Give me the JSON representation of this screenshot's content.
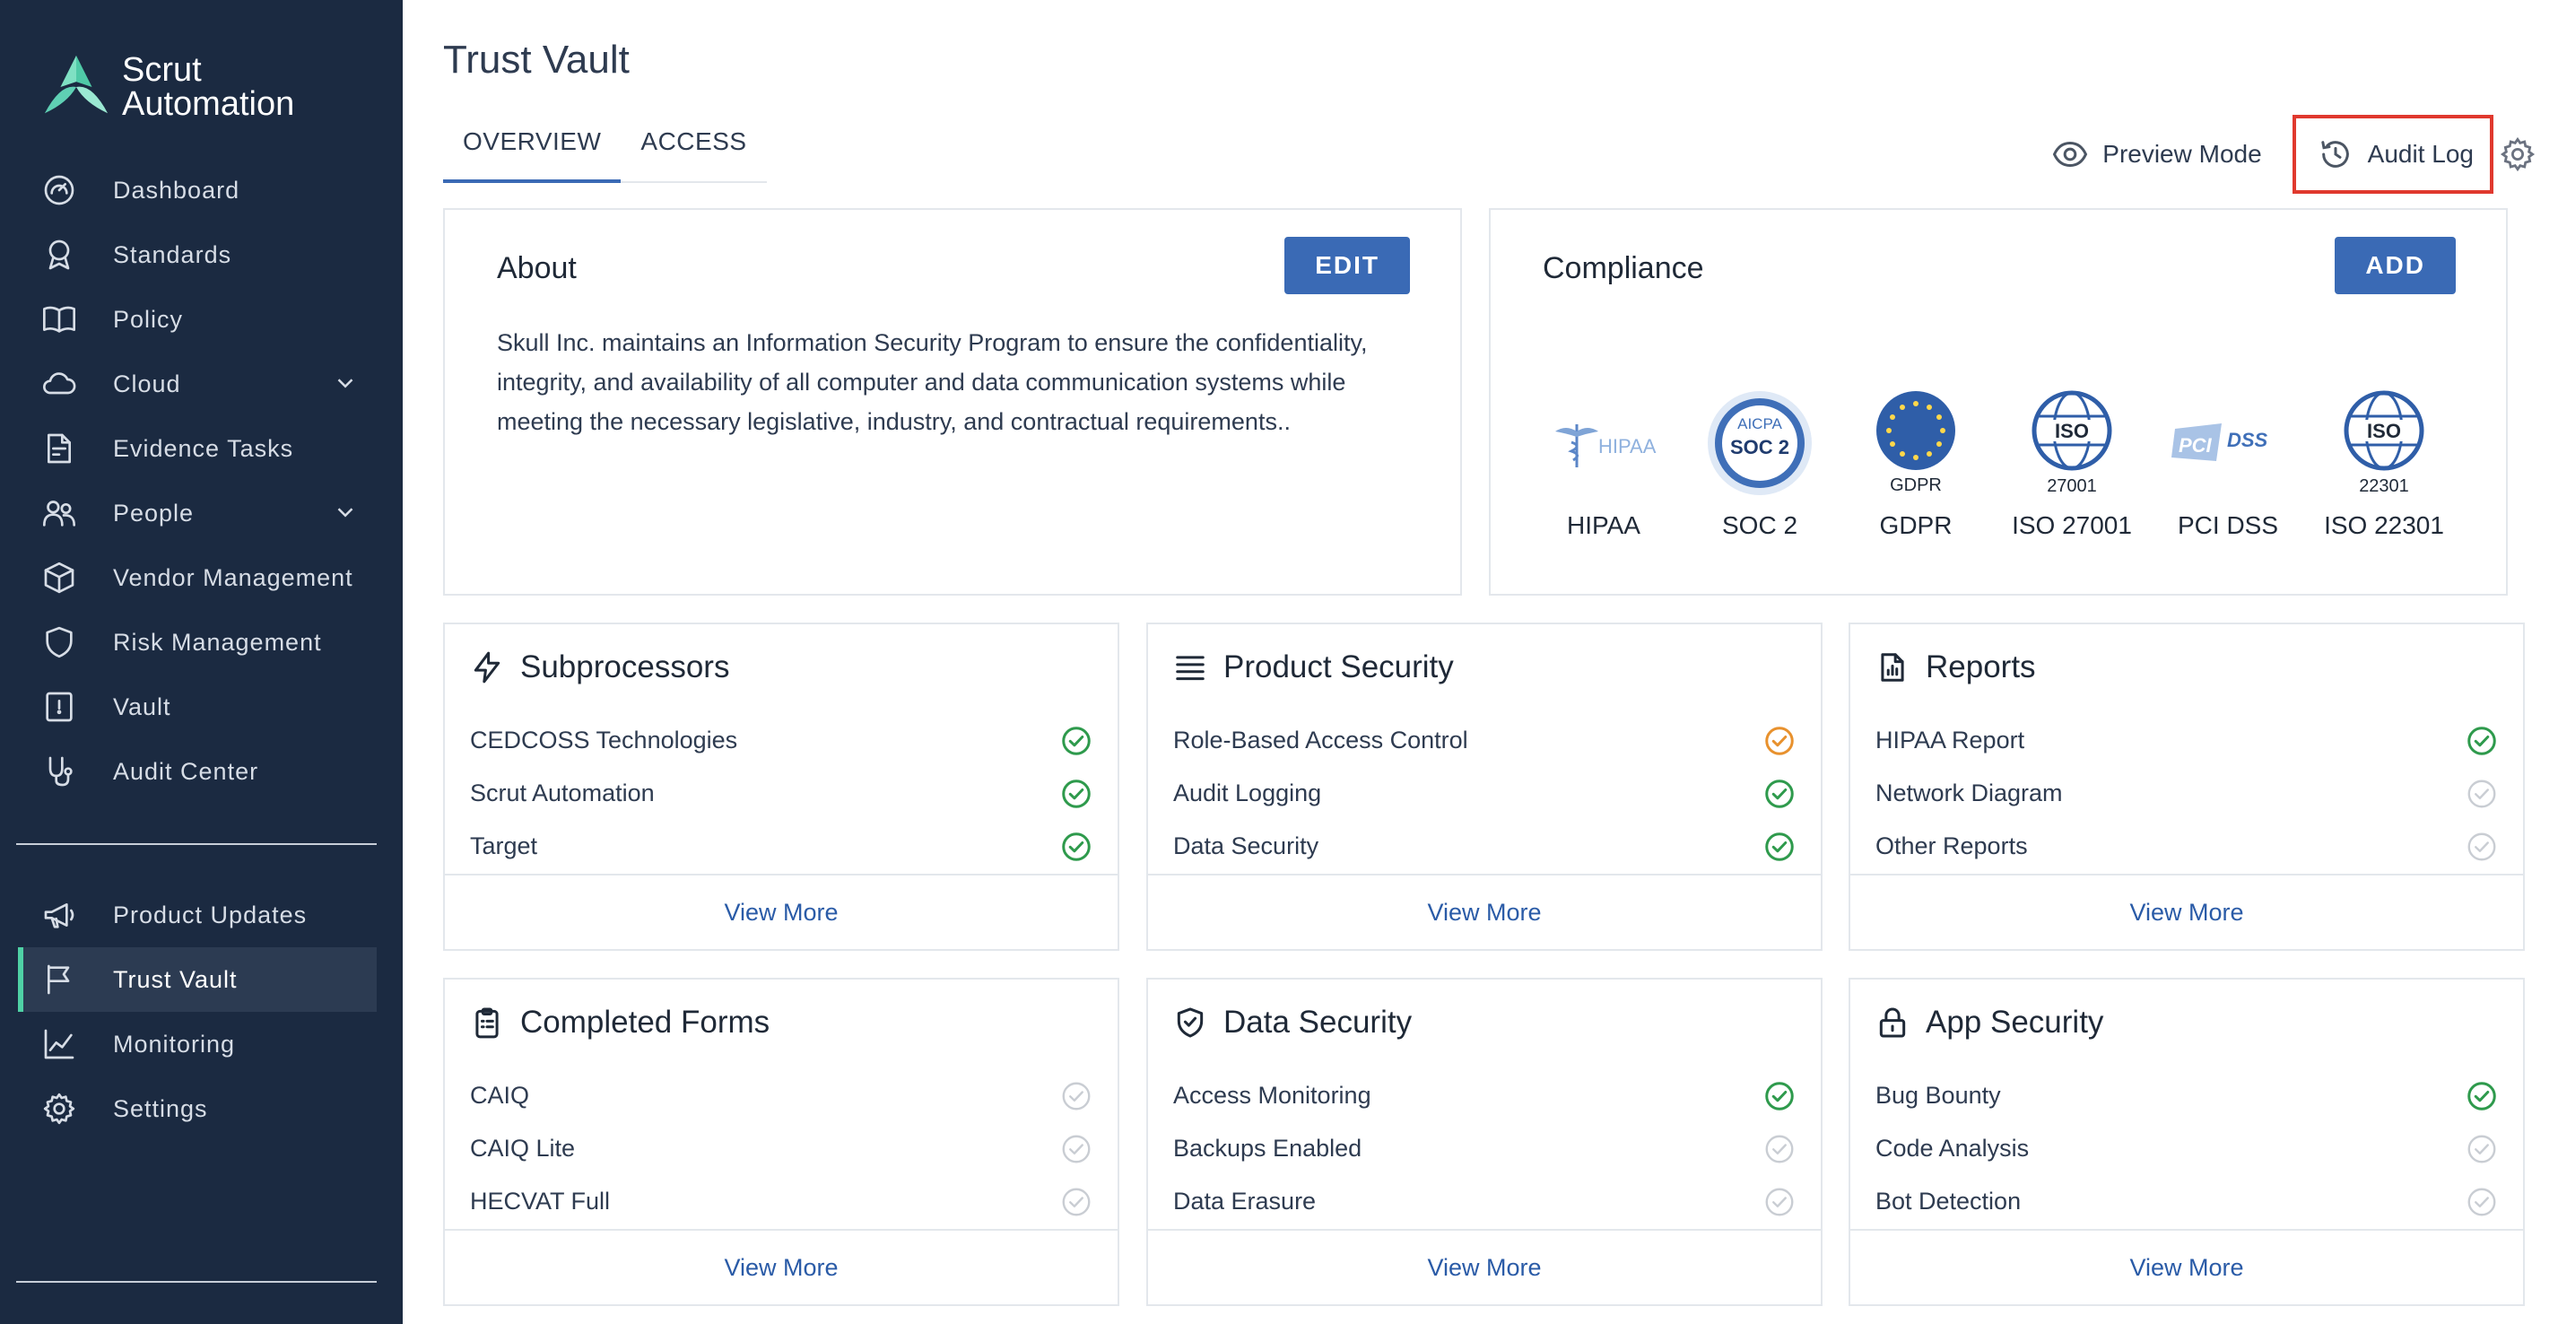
{
  "brand": {
    "line1": "Scrut",
    "line2": "Automation"
  },
  "sidebar": {
    "items": [
      {
        "label": "Dashboard",
        "icon": "dashboard-icon"
      },
      {
        "label": "Standards",
        "icon": "award-icon"
      },
      {
        "label": "Policy",
        "icon": "book-icon"
      },
      {
        "label": "Cloud",
        "icon": "cloud-icon",
        "expandable": true
      },
      {
        "label": "Evidence Tasks",
        "icon": "document-check-icon"
      },
      {
        "label": "People",
        "icon": "people-icon",
        "expandable": true
      },
      {
        "label": "Vendor Management",
        "icon": "box-icon"
      },
      {
        "label": "Risk Management",
        "icon": "shield-icon"
      },
      {
        "label": "Vault",
        "icon": "vault-icon"
      },
      {
        "label": "Audit Center",
        "icon": "stethoscope-icon"
      }
    ],
    "items2": [
      {
        "label": "Product Updates",
        "icon": "megaphone-icon"
      },
      {
        "label": "Trust Vault",
        "icon": "flag-icon",
        "active": true
      },
      {
        "label": "Monitoring",
        "icon": "chart-icon"
      },
      {
        "label": "Settings",
        "icon": "gear-icon"
      }
    ]
  },
  "page": {
    "title": "Trust Vault"
  },
  "tabs": [
    {
      "label": "OVERVIEW",
      "active": true
    },
    {
      "label": "ACCESS"
    }
  ],
  "header_actions": {
    "preview": "Preview Mode",
    "audit_log": "Audit Log"
  },
  "about": {
    "title": "About",
    "edit_label": "EDIT",
    "text": "Skull Inc. maintains an Information Security Program to ensure the confidentiality, integrity, and availability of all computer and data communication systems while meeting the necessary legislative, industry, and contractual requirements.."
  },
  "compliance": {
    "title": "Compliance",
    "add_label": "ADD",
    "badges": [
      {
        "name": "HIPAA",
        "logo_text": "HIPAA"
      },
      {
        "name": "SOC 2",
        "logo_top": "AICPA",
        "logo_main": "SOC 2"
      },
      {
        "name": "GDPR",
        "logo_sub": "GDPR"
      },
      {
        "name": "ISO 27001",
        "logo_main": "ISO",
        "logo_sub": "27001"
      },
      {
        "name": "PCI DSS",
        "logo_text": "PCI DSS"
      },
      {
        "name": "ISO 22301",
        "logo_main": "ISO",
        "logo_sub": "22301"
      }
    ]
  },
  "tiles": [
    {
      "title": "Subprocessors",
      "icon": "bolt-icon",
      "view_more": "View More",
      "rows": [
        {
          "label": "CEDCOSS Technologies",
          "status": "done"
        },
        {
          "label": "Scrut Automation",
          "status": "done"
        },
        {
          "label": "Target",
          "status": "done"
        }
      ]
    },
    {
      "title": "Product Security",
      "icon": "list-icon",
      "view_more": "View More",
      "rows": [
        {
          "label": "Role-Based Access Control",
          "status": "warning"
        },
        {
          "label": "Audit Logging",
          "status": "done"
        },
        {
          "label": "Data Security",
          "status": "done"
        }
      ]
    },
    {
      "title": "Reports",
      "icon": "report-icon",
      "view_more": "View More",
      "rows": [
        {
          "label": "HIPAA Report",
          "status": "done"
        },
        {
          "label": "Network Diagram",
          "status": "pending"
        },
        {
          "label": "Other Reports",
          "status": "pending"
        }
      ]
    },
    {
      "title": "Completed Forms",
      "icon": "clipboard-icon",
      "view_more": "View More",
      "rows": [
        {
          "label": "CAIQ",
          "status": "pending"
        },
        {
          "label": "CAIQ Lite",
          "status": "pending"
        },
        {
          "label": "HECVAT Full",
          "status": "pending"
        }
      ]
    },
    {
      "title": "Data Security",
      "icon": "shield-check-icon",
      "view_more": "View More",
      "rows": [
        {
          "label": "Access Monitoring",
          "status": "done"
        },
        {
          "label": "Backups Enabled",
          "status": "pending"
        },
        {
          "label": "Data Erasure",
          "status": "pending"
        }
      ]
    },
    {
      "title": "App Security",
      "icon": "lock-icon",
      "view_more": "View More",
      "rows": [
        {
          "label": "Bug Bounty",
          "status": "done"
        },
        {
          "label": "Code Analysis",
          "status": "pending"
        },
        {
          "label": "Bot Detection",
          "status": "pending"
        }
      ]
    }
  ],
  "colors": {
    "sidebar": "#1b2a41",
    "accent": "#3a6ab5",
    "done": "#2e9a4c",
    "warning": "#e8912d",
    "pending": "#c9cdd3",
    "highlight": "#e0392e"
  }
}
